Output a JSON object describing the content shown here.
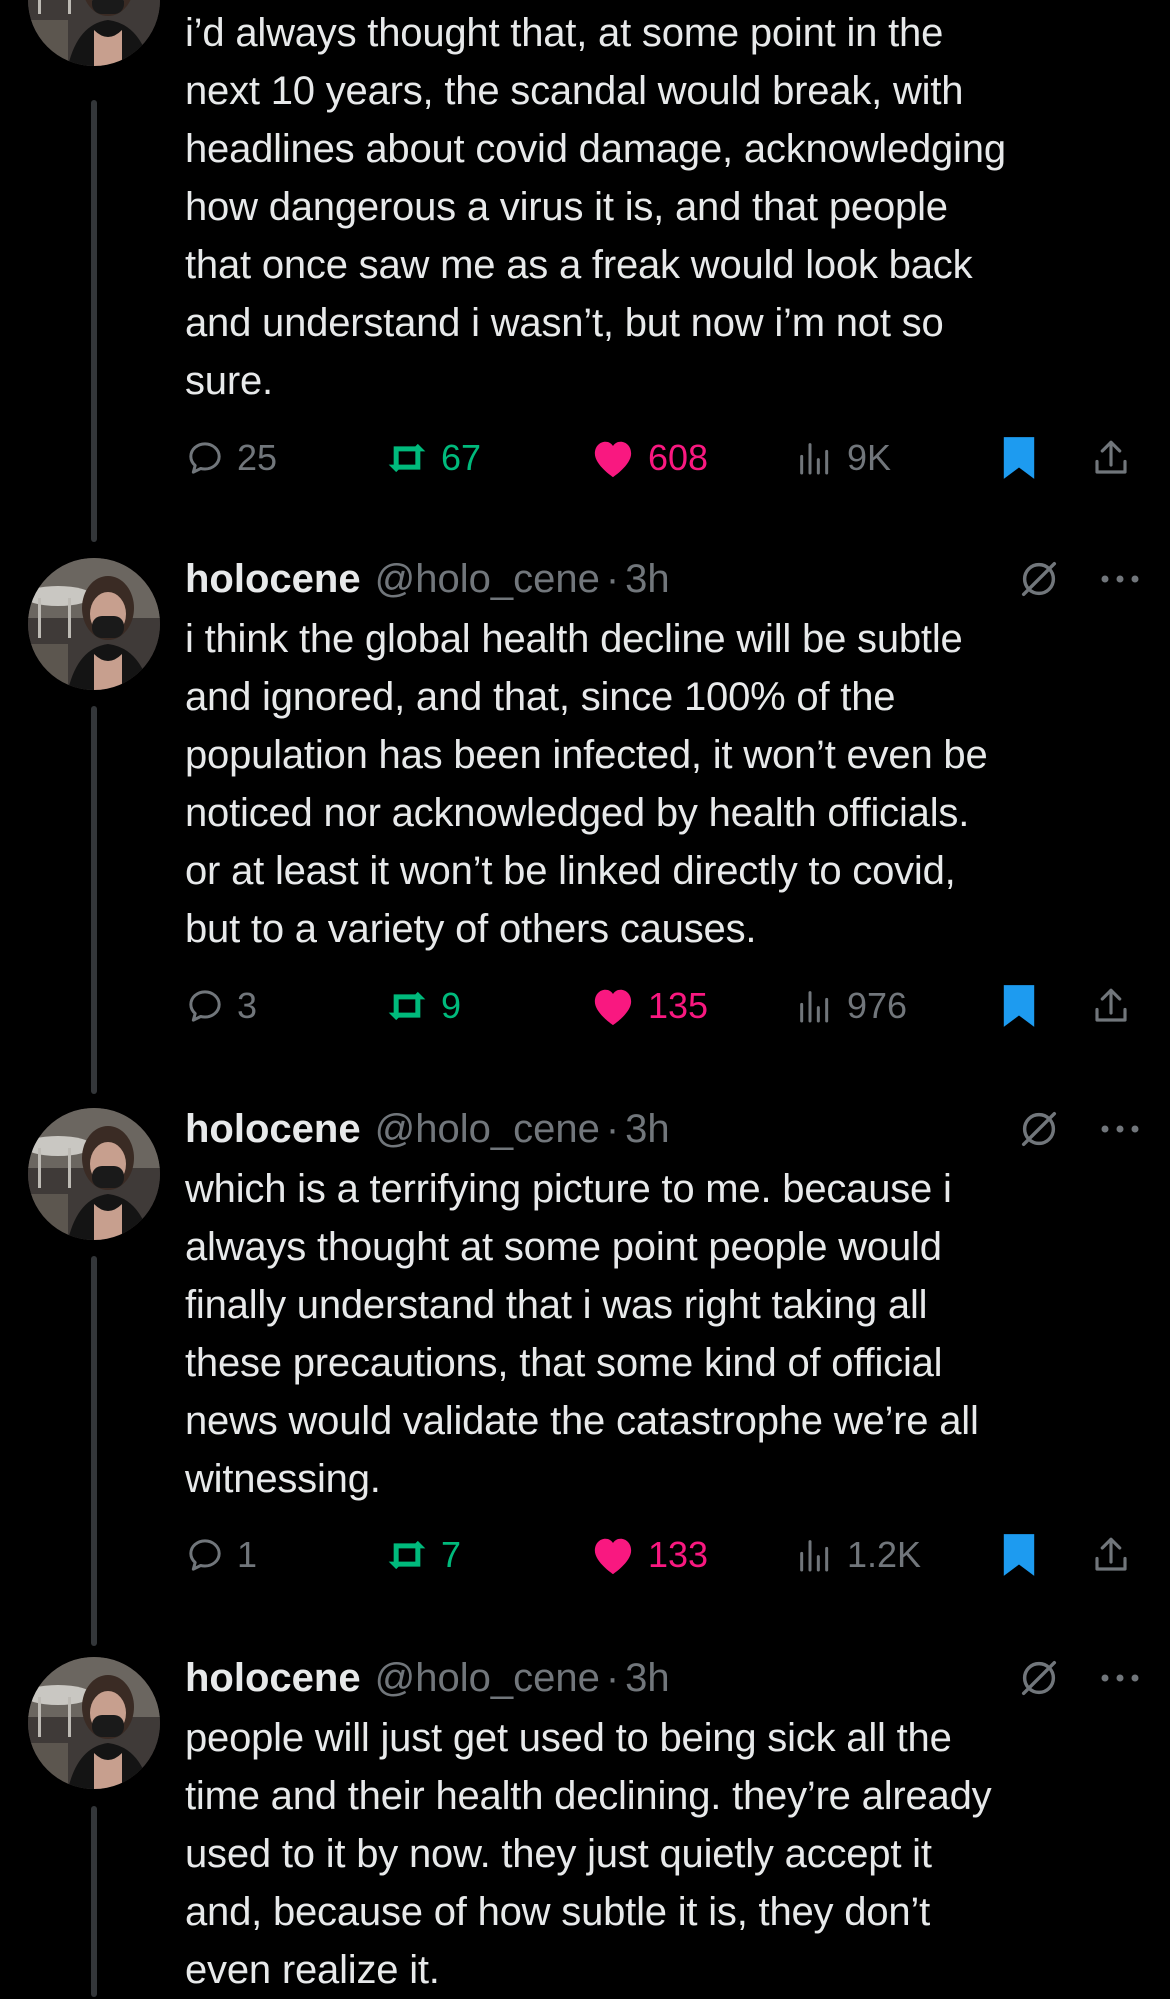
{
  "tweets": [
    {
      "show_header": false,
      "text": "i’d always thought that, at some point in the\nnext 10 years, the scandal would break, with\nheadlines about covid damage, acknowledging\nhow dangerous a virus it is, and that people\nthat once saw me as a freak would look back\nand understand i wasn’t, but now i’m not so\nsure.",
      "replies": "25",
      "retweets": "67",
      "likes": "608",
      "views": "9K"
    },
    {
      "show_header": true,
      "display_name": "holocene",
      "handle": "@holo_cene",
      "time": "3h",
      "text": "i think the global health decline will be subtle\nand ignored, and that, since 100% of the\npopulation has been infected, it won’t even be\nnoticed nor acknowledged by health officials.\nor at least it won’t be linked directly to covid,\nbut to a variety of others causes.",
      "replies": "3",
      "retweets": "9",
      "likes": "135",
      "views": "976"
    },
    {
      "show_header": true,
      "display_name": "holocene",
      "handle": "@holo_cene",
      "time": "3h",
      "text": "which is a terrifying picture to me. because i\nalways thought at some point people would\nfinally understand that i was right taking all\nthese precautions, that some kind of official\nnews would validate the catastrophe we’re all\nwitnessing.",
      "replies": "1",
      "retweets": "7",
      "likes": "133",
      "views": "1.2K"
    },
    {
      "show_header": true,
      "display_name": "holocene",
      "handle": "@holo_cene",
      "time": "3h",
      "text": "people will just get used to being sick all the\ntime and their health declining. they’re already\nused to it by now. they just quietly accept it\nand, because of how subtle it is, they don’t\neven realize it."
    }
  ],
  "dot": "·",
  "icons": {
    "reply": "reply-icon",
    "retweet": "retweet-icon",
    "like": "heart-icon-filled",
    "views": "views-icon",
    "bookmark": "bookmark-icon-filled",
    "share": "share-icon",
    "mute": "muted-icon",
    "more": "more-icon"
  },
  "colors": {
    "background": "#000000",
    "text": "#e7e9ea",
    "secondary": "#71767b",
    "retweet": "#00ba7c",
    "like": "#f91880",
    "bookmark": "#1d9bf0"
  }
}
